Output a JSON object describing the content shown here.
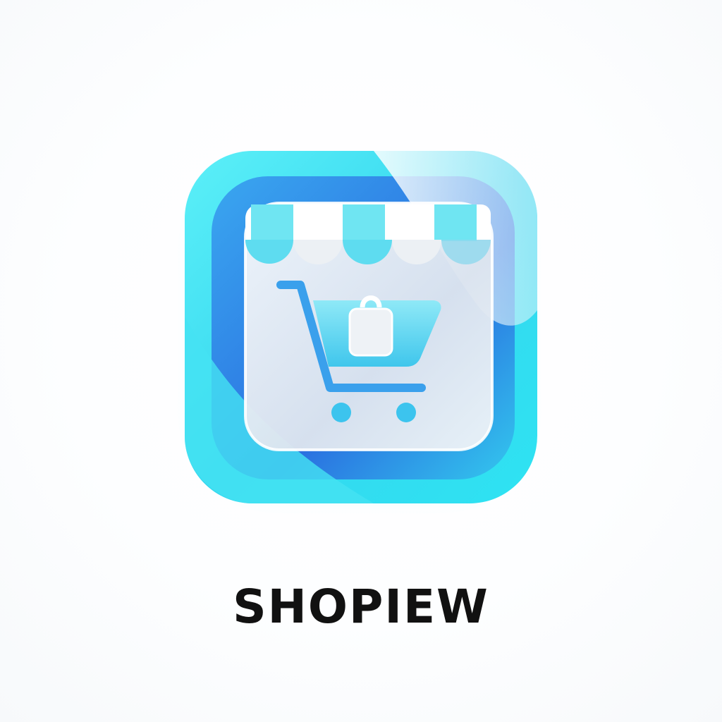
{
  "brand": {
    "name": "SHOPIEW",
    "colors": {
      "cyan": "#3fe3f0",
      "blue": "#2f7fe6",
      "glass": "#e8eef6",
      "text": "#111111"
    }
  },
  "logo": {
    "icon": "storefront-cart-icon",
    "parts": [
      "awning-icon",
      "shopping-cart-icon",
      "shopping-bag-icon"
    ]
  }
}
